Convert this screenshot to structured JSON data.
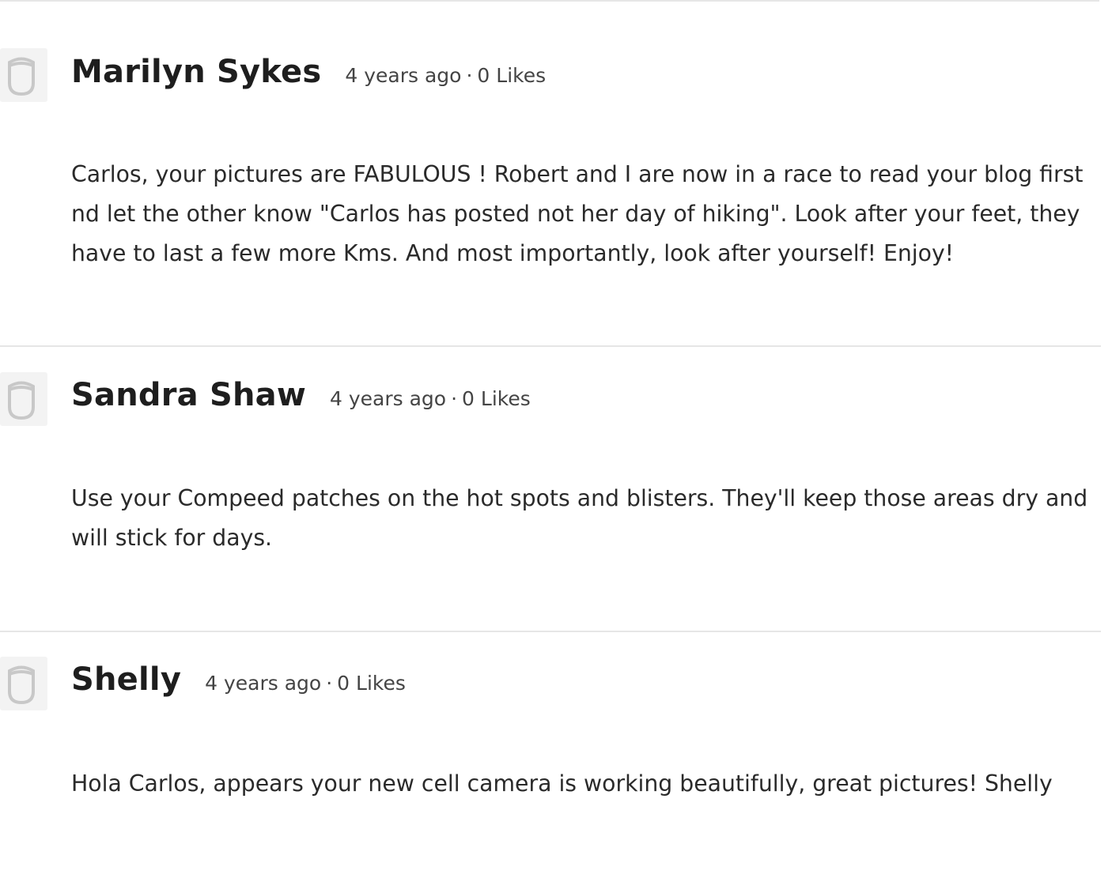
{
  "comments": [
    {
      "author": "Marilyn Sykes",
      "time": "4 years ago",
      "separator": "·",
      "likes": "0 Likes",
      "text": "Carlos, your pictures are FABULOUS ! Robert and I are now in a race to read your blog first nd let the other know \"Carlos has posted not her day of hiking\". Look after your feet, they have to last a few more Kms. And most importantly, look after yourself! Enjoy!"
    },
    {
      "author": "Sandra Shaw",
      "time": "4 years ago",
      "separator": "·",
      "likes": "0 Likes",
      "text": "Use your Compeed patches on the hot spots and blisters. They'll keep those areas dry and will stick for days."
    },
    {
      "author": "Shelly",
      "time": "4 years ago",
      "separator": "·",
      "likes": "0 Likes",
      "text": "Hola Carlos, appears your new cell camera is working beautifully, great pictures! Shelly"
    }
  ],
  "colors": {
    "divider": "#e6e6e6",
    "avatar_bg": "#f3f3f3",
    "avatar_icon": "#c8c8c8",
    "text": "#222222"
  },
  "icons": {
    "avatar": "default-avatar-icon"
  }
}
